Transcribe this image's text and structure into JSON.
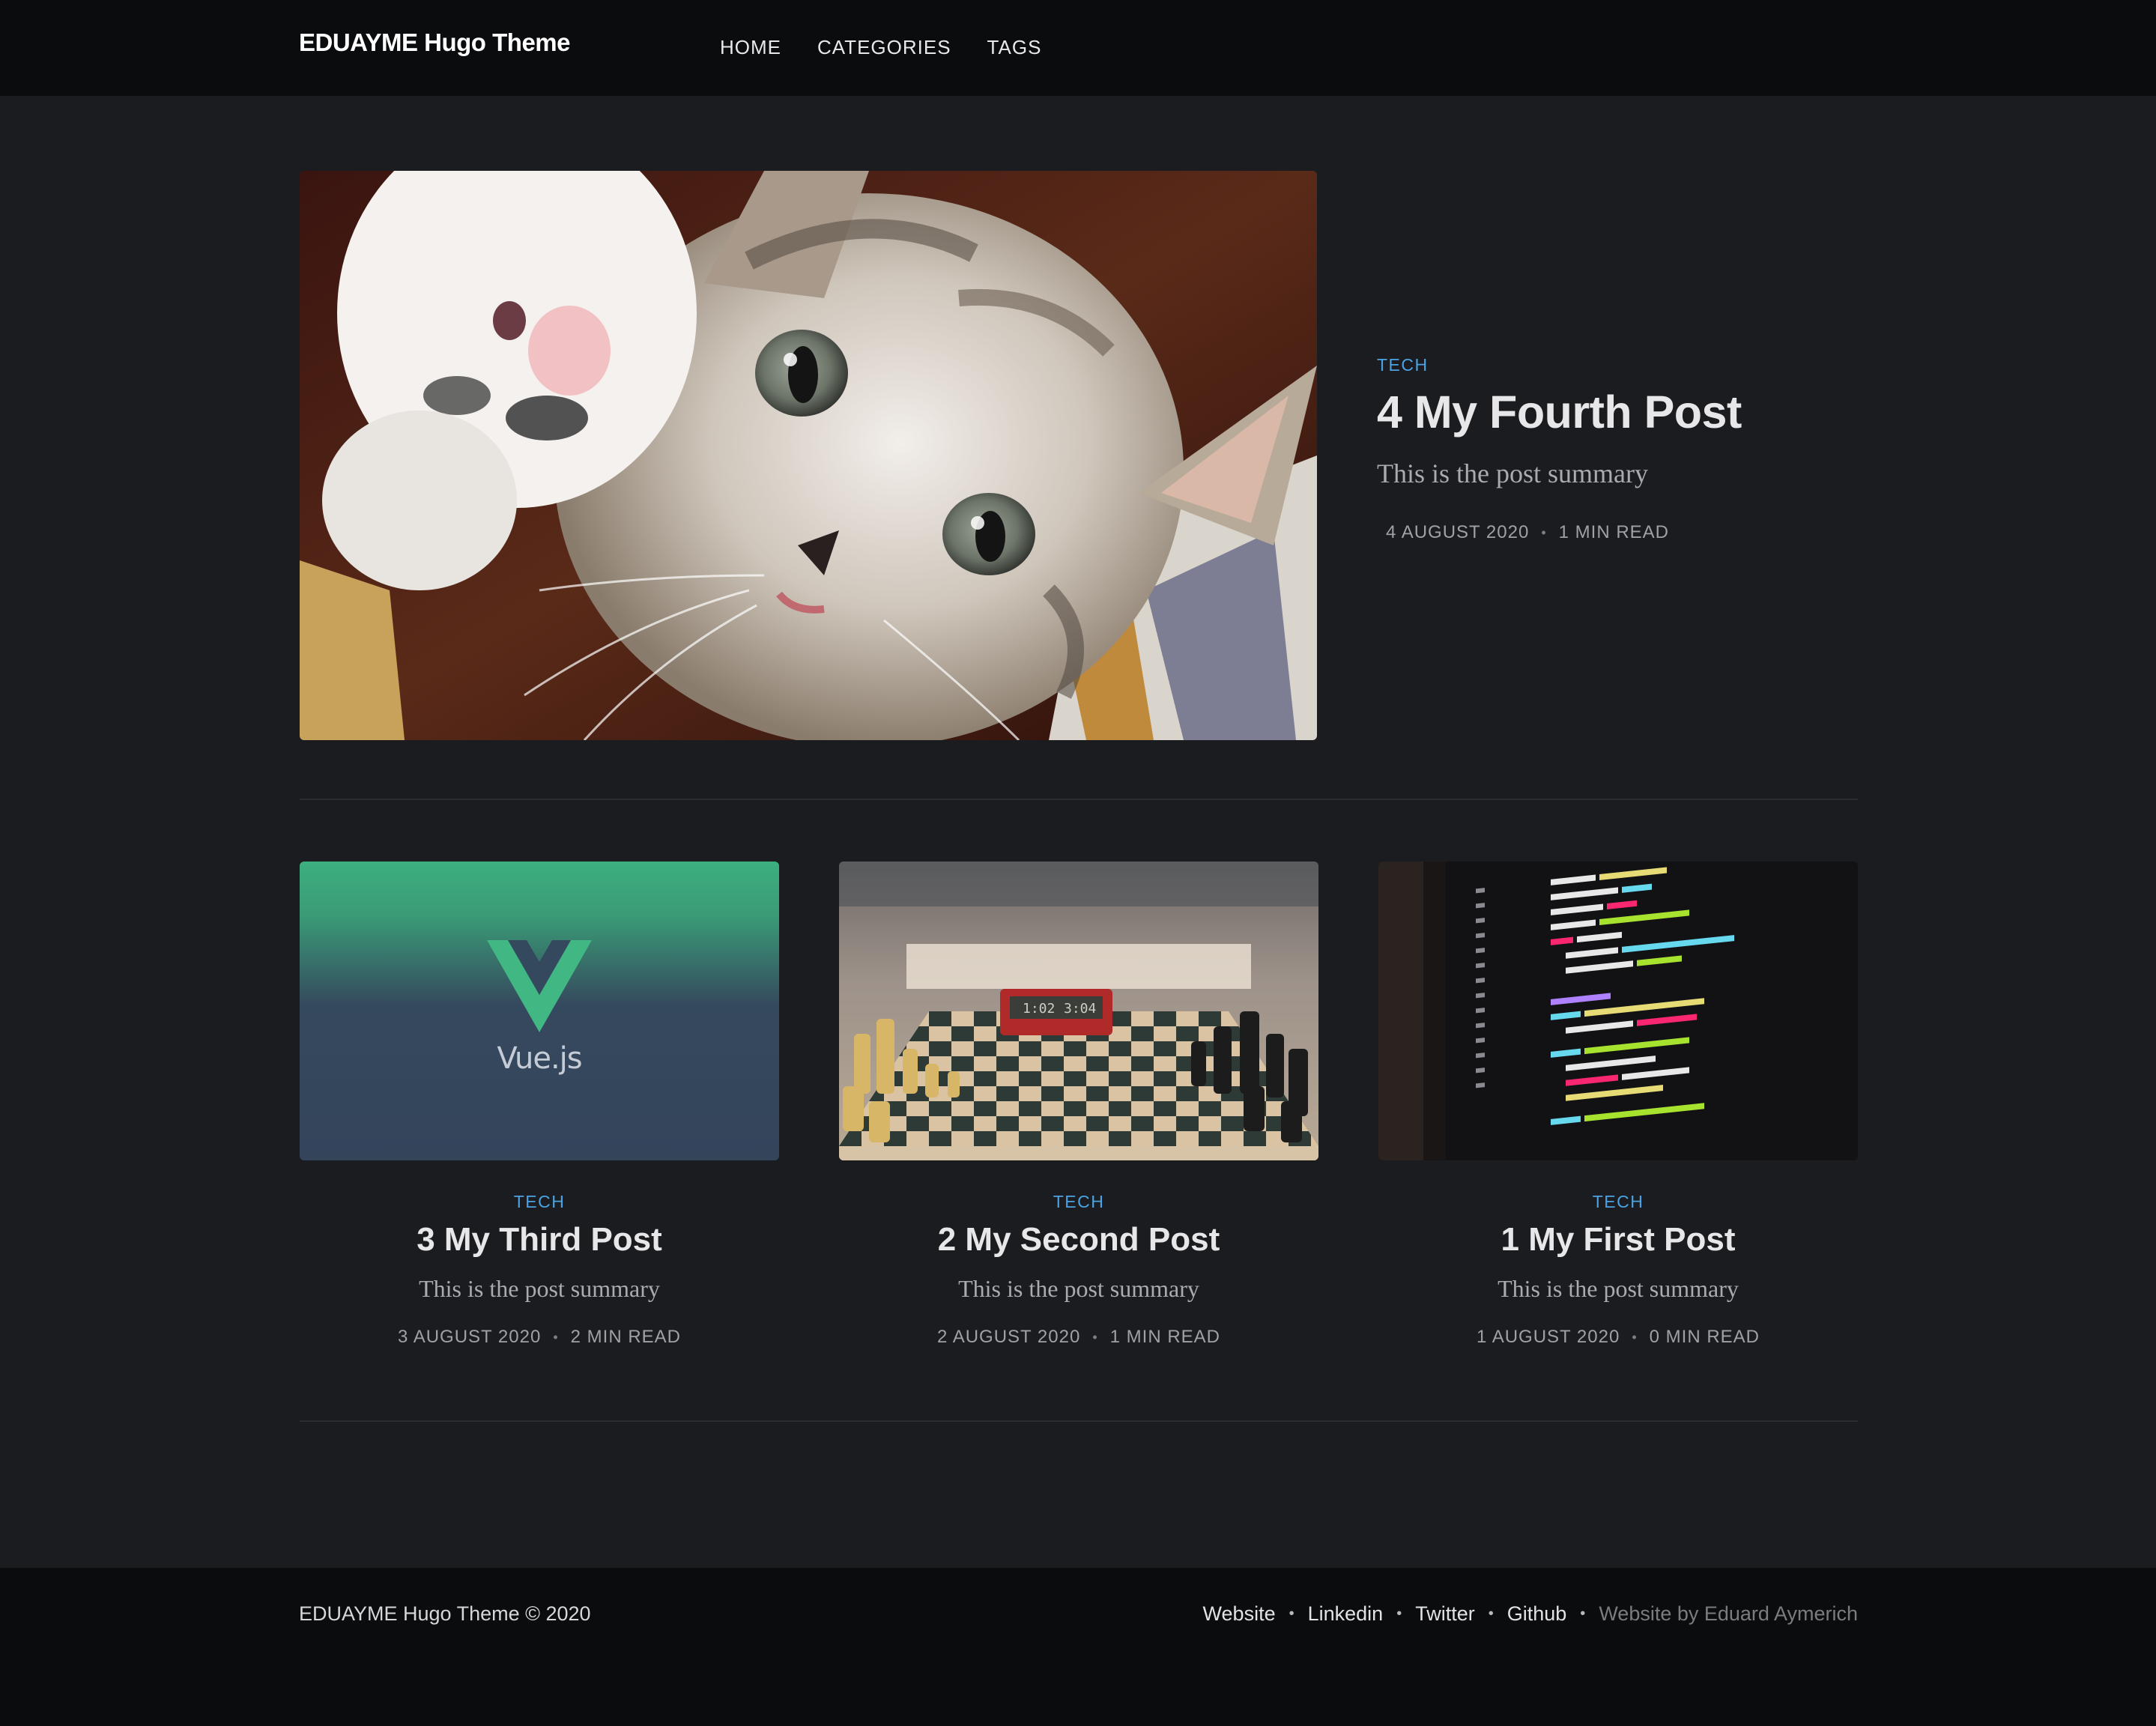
{
  "header": {
    "brand": "EDUAYME Hugo Theme",
    "nav": [
      "HOME",
      "CATEGORIES",
      "TAGS"
    ]
  },
  "featured": {
    "image": "kitten photo",
    "category": "TECH",
    "title": "4 My Fourth Post",
    "summary": "This is the post summary",
    "date": "4 AUGUST 2020",
    "read_time": "1 MIN READ"
  },
  "posts": [
    {
      "image": "Vue.js logo",
      "image_text": "Vue.js",
      "category": "TECH",
      "title": "3 My Third Post",
      "summary": "This is the post summary",
      "date": "3 AUGUST 2020",
      "read_time": "2 MIN READ"
    },
    {
      "image": "chess board photo",
      "clock_left": "1:02",
      "clock_right": "3:04",
      "category": "TECH",
      "title": "2 My Second Post",
      "summary": "This is the post summary",
      "date": "2 AUGUST 2020",
      "read_time": "1 MIN READ"
    },
    {
      "image": "code on monitor photo",
      "category": "TECH",
      "title": "1 My First Post",
      "summary": "This is the post summary",
      "date": "1 AUGUST 2020",
      "read_time": "0 MIN READ"
    }
  ],
  "footer": {
    "copyright": "EDUAYME Hugo Theme © 2020",
    "links": [
      "Website",
      "Linkedin",
      "Twitter",
      "Github"
    ],
    "credit": "Website by Eduard Aymerich"
  },
  "colors": {
    "background": "#1b1c20",
    "header_footer": "#0b0c0e",
    "tag_accent": "#4ba3e3",
    "vue_green": "#41b883",
    "vue_navy": "#35495e"
  }
}
